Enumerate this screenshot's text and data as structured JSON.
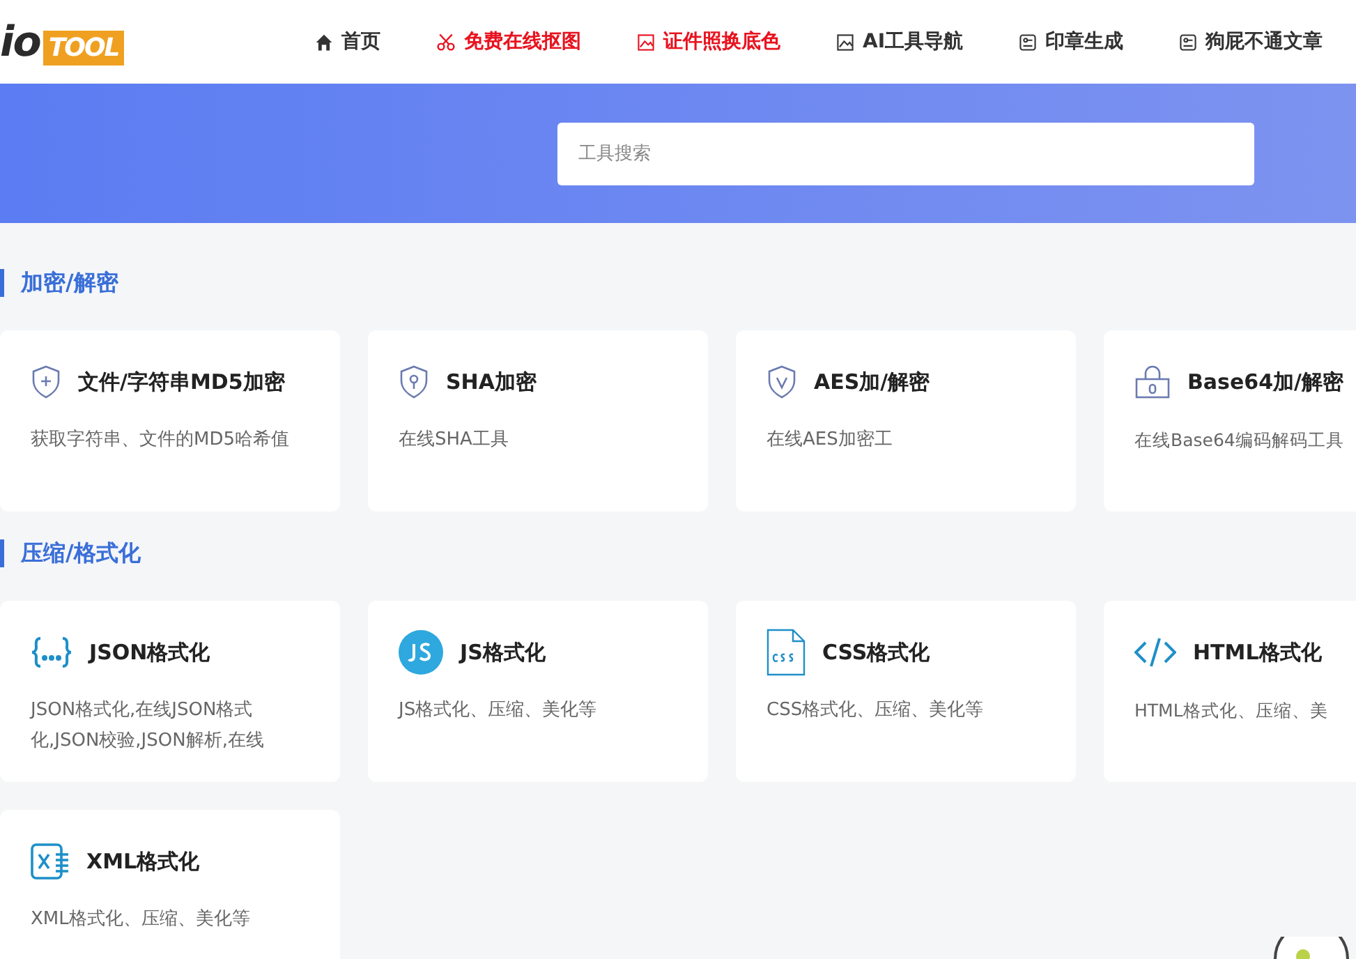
{
  "header": {
    "logo": {
      "part_1": "io",
      "part_2": "TOOL"
    },
    "nav": [
      {
        "label": "首页",
        "kind": "home",
        "highlight": false
      },
      {
        "label": "免费在线抠图",
        "kind": "scissors",
        "highlight": true
      },
      {
        "label": "证件照换底色",
        "kind": "image",
        "highlight": true
      },
      {
        "label": "AI工具导航",
        "kind": "image",
        "highlight": false
      },
      {
        "label": "印章生成",
        "kind": "stamp",
        "highlight": false
      },
      {
        "label": "狗屁不通文章",
        "kind": "stamp",
        "highlight": false
      }
    ]
  },
  "search": {
    "placeholder": "工具搜索"
  },
  "sections": [
    {
      "title": "加密/解密",
      "cards": [
        {
          "kind": "md5",
          "title": "文件/字符串MD5加密",
          "description": "获取字符串、文件的MD5哈希值"
        },
        {
          "kind": "sha",
          "title": "SHA加密",
          "description": "在线SHA工具"
        },
        {
          "kind": "aes",
          "title": "AES加/解密",
          "description": "在线AES加密工"
        },
        {
          "kind": "base64",
          "title": "Base64加/解密",
          "description": "在线Base64编码解码工具"
        }
      ]
    },
    {
      "title": "压缩/格式化",
      "cards": [
        {
          "kind": "json",
          "title": "JSON格式化",
          "description": "JSON格式化,在线JSON格式化,JSON校验,JSON解析,在线"
        },
        {
          "kind": "js",
          "title": "JS格式化",
          "description": "JS格式化、压缩、美化等"
        },
        {
          "kind": "css",
          "title": "CSS格式化",
          "description": "CSS格式化、压缩、美化等"
        },
        {
          "kind": "html",
          "title": "HTML格式化",
          "description": "HTML格式化、压缩、美"
        },
        {
          "kind": "xml",
          "title": "XML格式化",
          "description": "XML格式化、压缩、美化等"
        }
      ]
    }
  ]
}
